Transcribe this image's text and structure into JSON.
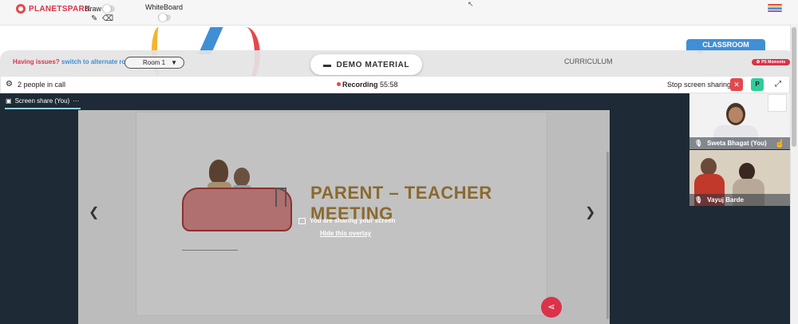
{
  "app": {
    "logo_text": "PLANETSPARK",
    "draw_label": "Draw",
    "whiteboard_label": "WhiteBoard"
  },
  "nav": {
    "classroom_tab": "CLASSROOM",
    "curriculum": "CURRICULUM",
    "demo_material": "DEMO MATERIAL",
    "ps_moments": "PS Moments"
  },
  "issues": {
    "question": "Having issues?",
    "action": "switch to alternate room"
  },
  "room_select": {
    "value": "Room 1"
  },
  "call": {
    "people": "2 people in call",
    "recording_label": "Recording",
    "recording_time": "55:58",
    "stop_sharing": "Stop screen sharing",
    "participant_initial": "P"
  },
  "stage": {
    "share_tab": "Screen share (You)",
    "share_more": "···",
    "slide_title": "PARENT – TEACHER MEETING",
    "overlay_message": "You are sharing your screen",
    "hide_overlay": "Hide this overlay"
  },
  "participants": [
    {
      "name": "Sweta Bhagat (You)"
    },
    {
      "name": "Vayuj Barde"
    }
  ],
  "colors": {
    "brand_red": "#d9334a",
    "brand_blue": "#3f8fd6",
    "stage_bg": "#1e2a35",
    "accent_green": "#2ecc9a"
  },
  "icons": {
    "gear": "gear-icon",
    "folder": "folder-icon",
    "share_fab": "share-icon",
    "pencil": "pencil-icon",
    "eraser": "eraser-icon"
  }
}
